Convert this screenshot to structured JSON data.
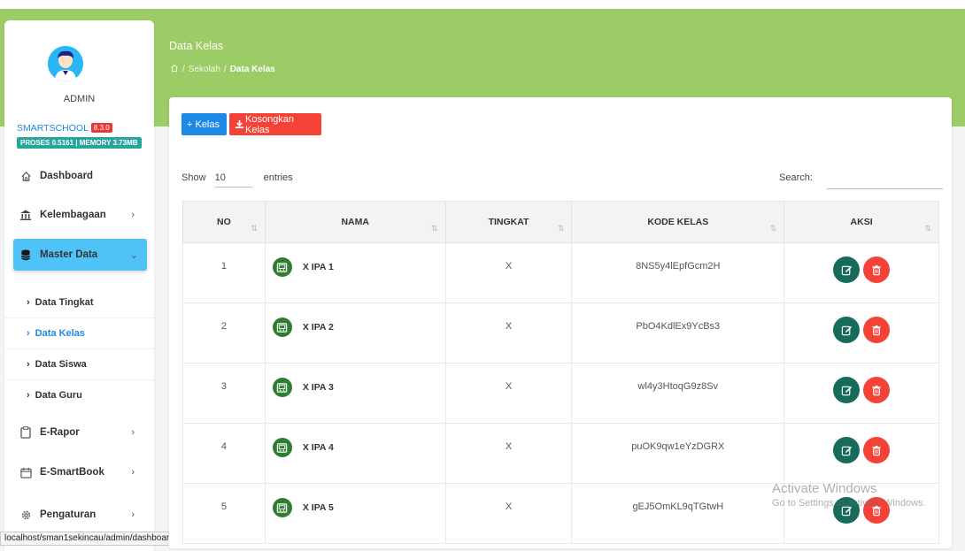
{
  "sidebar": {
    "admin_name": "ADMIN",
    "brand": "SMARTSCHOOL",
    "version": "8.3.0",
    "stats": "PROSES 0.5161 | MEMORY 3.73MB",
    "nav": [
      {
        "label": "Dashboard",
        "icon": "home-icon"
      },
      {
        "label": "Kelembagaan",
        "icon": "institution-icon",
        "chevron": "›"
      },
      {
        "label": "Master Data",
        "icon": "database-icon",
        "chevron": "⌄"
      },
      {
        "label": "E-Rapor",
        "icon": "clipboard-icon",
        "chevron": "›"
      },
      {
        "label": "E-SmartBook",
        "icon": "calendar-icon",
        "chevron": "›"
      },
      {
        "label": "Pengaturan",
        "icon": "gear-icon",
        "chevron": "›"
      }
    ],
    "subnav": [
      {
        "label": "Data Tingkat"
      },
      {
        "label": "Data Kelas"
      },
      {
        "label": "Data Siswa"
      },
      {
        "label": "Data Guru"
      }
    ],
    "accent_color": "#4fc3f7"
  },
  "header": {
    "title": "Data Kelas",
    "breadcrumb": {
      "sep": "/",
      "parent": "Sekolah",
      "current": "Data Kelas"
    },
    "band_color": "#9ccc65"
  },
  "toolbar": {
    "add_label": "+ Kelas",
    "empty_label": "Kosongkan Kelas"
  },
  "table_controls": {
    "show_label": "Show",
    "entries_value": "10",
    "entries_label": "entries",
    "search_label": "Search:",
    "search_value": ""
  },
  "table": {
    "headers": [
      "NO",
      "NAMA",
      "TINGKAT",
      "KODE KELAS",
      "AKSI"
    ],
    "sort_glyph": "⇅",
    "rows": [
      {
        "no": "1",
        "nama": "X IPA 1",
        "tingkat": "X",
        "kode": "8NS5y4lEpfGcm2H"
      },
      {
        "no": "2",
        "nama": "X IPA 2",
        "tingkat": "X",
        "kode": "PbO4KdlEx9YcBs3"
      },
      {
        "no": "3",
        "nama": "X IPA 3",
        "tingkat": "X",
        "kode": "wl4y3HtoqG9z8Sv"
      },
      {
        "no": "4",
        "nama": "X IPA 4",
        "tingkat": "X",
        "kode": "puOK9qw1eYzDGRX"
      },
      {
        "no": "5",
        "nama": "X IPA 5",
        "tingkat": "X",
        "kode": "gEJ5OmKL9qTGtwH"
      }
    ]
  },
  "status_bar": "localhost/sman1sekincau/admin/dashboard",
  "watermark": {
    "line1": "Activate Windows",
    "line2": "Go to Settings to activate Windows."
  }
}
